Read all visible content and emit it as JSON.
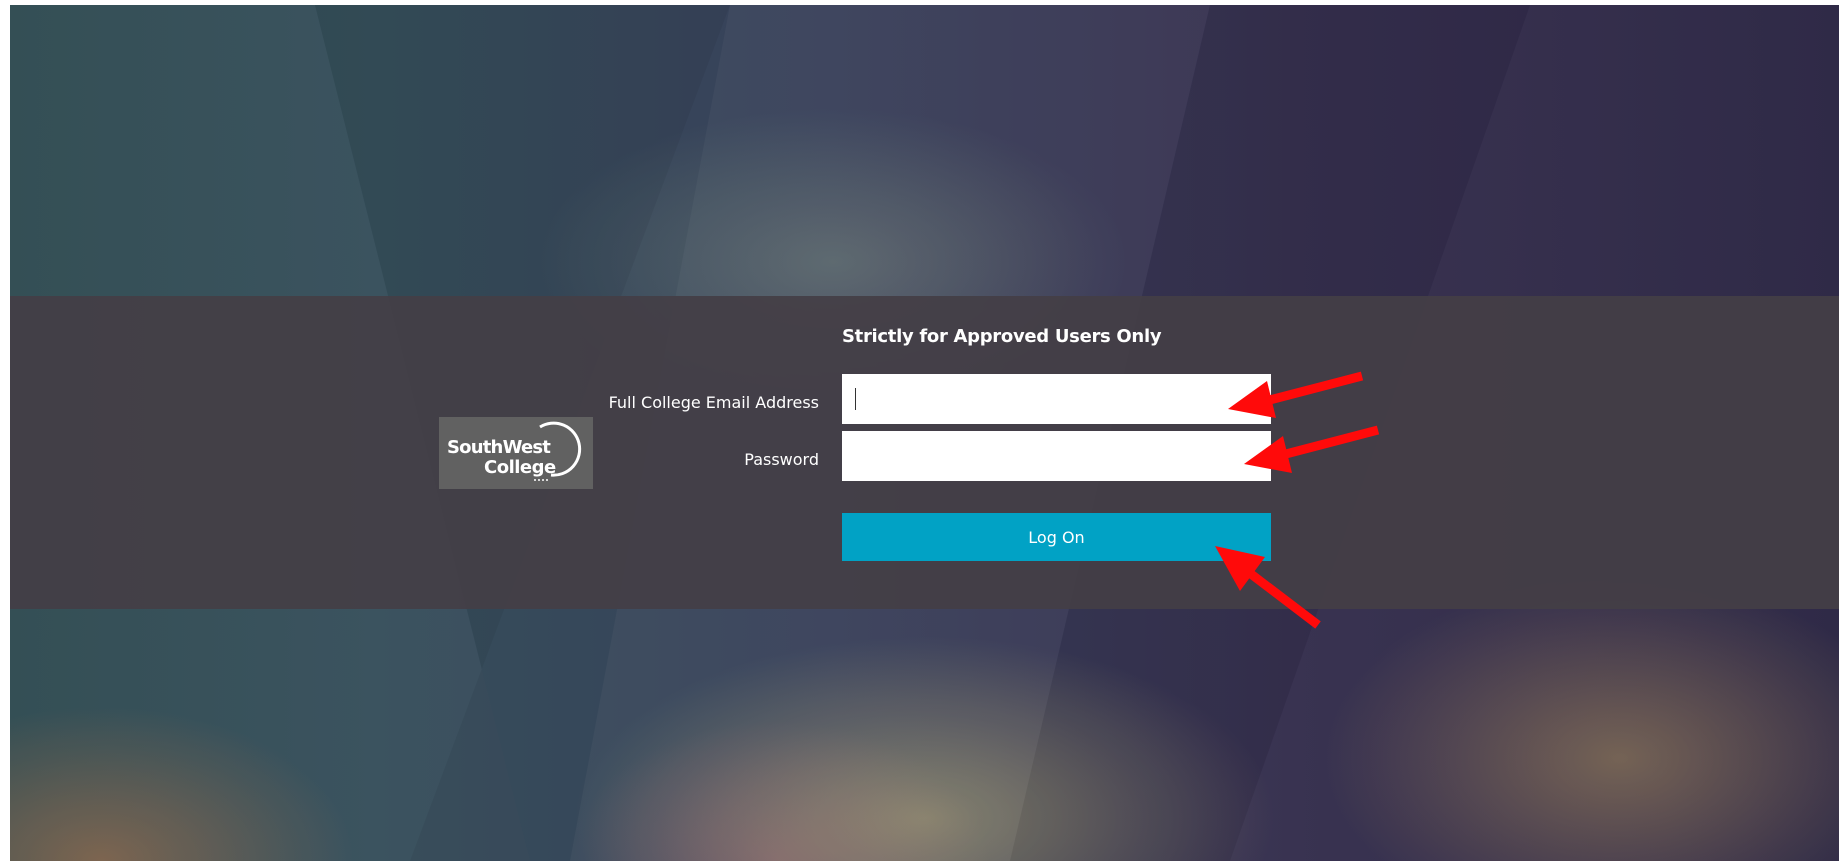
{
  "login_form": {
    "heading": "Strictly for Approved Users Only",
    "email_label": "Full College Email Address",
    "email_value": "",
    "password_label": "Password",
    "password_value": "",
    "submit_label": "Log On"
  },
  "logo": {
    "text_line1": "SouthWest",
    "text_line2": "College"
  },
  "annotations": {
    "arrow_color": "#ff0a0a",
    "arrow_count": 3,
    "arrow_icon": "red-arrow-icon"
  },
  "colors": {
    "button": "#01a2c5",
    "band": "#443e46",
    "logo_background": "#616161"
  }
}
